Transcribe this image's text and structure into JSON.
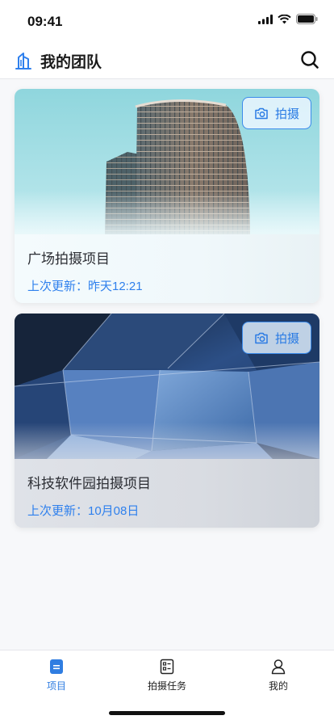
{
  "status_bar": {
    "time": "09:41"
  },
  "header": {
    "title": "我的团队"
  },
  "projects": [
    {
      "title": "广场拍摄项目",
      "update": "上次更新：昨天12:21",
      "button": "拍摄"
    },
    {
      "title": "科技软件园拍摄项目",
      "update": "上次更新：10月08日",
      "button": "拍摄"
    }
  ],
  "tabs": [
    {
      "label": "项目",
      "active": true
    },
    {
      "label": "拍摄任务",
      "active": false
    },
    {
      "label": "我的",
      "active": false
    }
  ],
  "colors": {
    "accent": "#2f80ed",
    "background": "#f7f8fa"
  },
  "icons": [
    "building-icon",
    "search-icon",
    "camera-icon",
    "document-icon",
    "task-list-icon",
    "user-icon"
  ]
}
